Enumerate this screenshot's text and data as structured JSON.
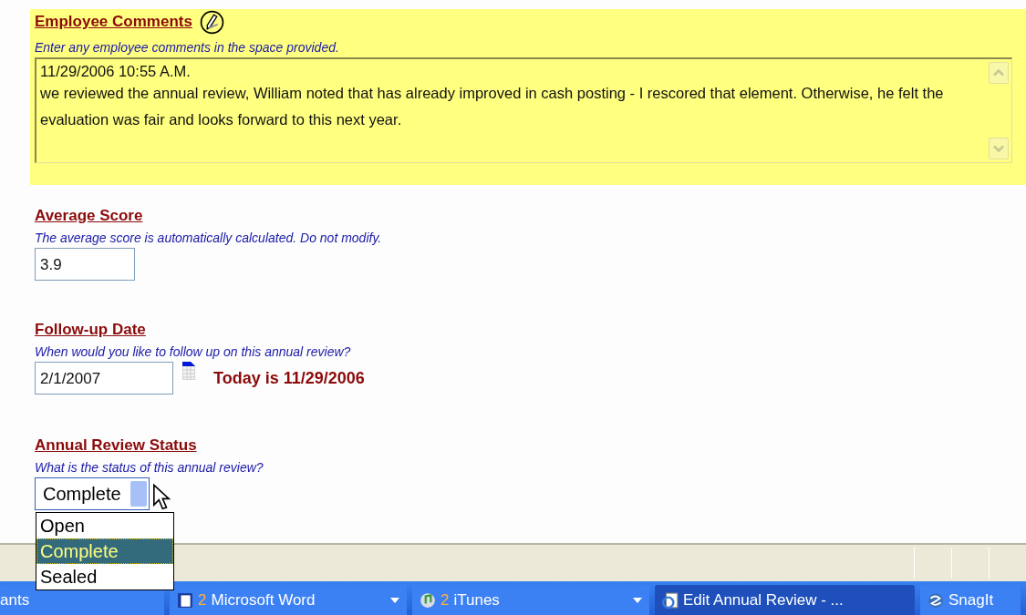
{
  "comments": {
    "title": "Employee Comments",
    "hint": "Enter any employee comments in the space provided.",
    "lines": [
      "11/29/2006 10:55 A.M.",
      "we reviewed the annual review, William noted that has already improved in cash posting - I rescored that element.  Otherwise, he felt the evaluation was fair and looks forward to this next year."
    ]
  },
  "average": {
    "title": "Average Score",
    "hint": "The average score is automatically calculated. Do not modify.",
    "value": "3.9"
  },
  "followup": {
    "title": "Follow-up Date",
    "hint": "When would you like to follow up on this annual review?",
    "value": "2/1/2007",
    "today": "Today is 11/29/2006"
  },
  "status": {
    "title": "Annual Review Status",
    "hint": "What is the status of this annual review?",
    "value": "Complete",
    "expanded": true,
    "options": [
      {
        "label": "Open",
        "selected": false
      },
      {
        "label": "Complete",
        "selected": true
      },
      {
        "label": "Sealed",
        "selected": false
      }
    ]
  },
  "taskbar": [
    {
      "label": "ants",
      "active": false,
      "kind": "plain"
    },
    {
      "count": "2",
      "label": "Microsoft Word",
      "active": false,
      "kind": "word"
    },
    {
      "count": "2",
      "label": "iTunes",
      "active": false,
      "kind": "itunes"
    },
    {
      "label": "Edit Annual Review - ...",
      "active": true,
      "kind": "browser"
    },
    {
      "label": "SnagIt",
      "active": false,
      "kind": "snagit"
    }
  ]
}
